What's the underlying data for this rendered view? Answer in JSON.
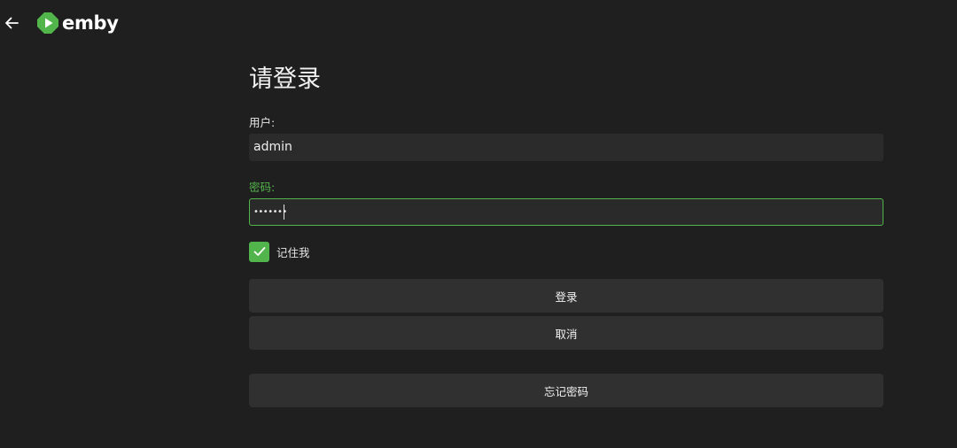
{
  "header": {
    "back_icon": "arrow-left-icon",
    "logo_icon": "emby-logo-icon",
    "logo_text": "emby",
    "brand_color": "#52b54b"
  },
  "form": {
    "title": "请登录",
    "username_label": "用户:",
    "username_value": "admin",
    "password_label": "密码:",
    "password_mask": "•••••••",
    "remember_label": "记住我",
    "remember_checked": true,
    "login_label": "登录",
    "cancel_label": "取消",
    "forgot_label": "忘记密码"
  },
  "colors": {
    "background": "#1f1f1f",
    "accent": "#52b54b",
    "input_bg": "#2b2b2b",
    "button_bg": "#303030"
  }
}
